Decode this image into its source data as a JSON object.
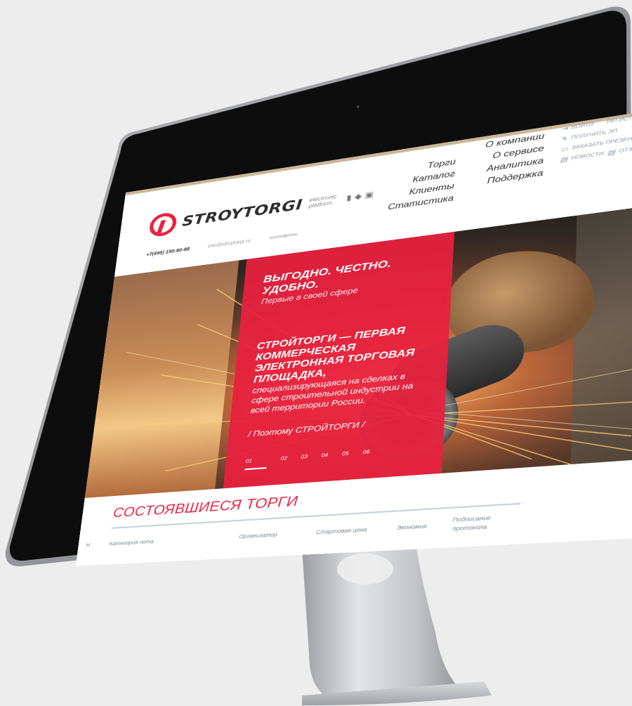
{
  "brand": {
    "name": "STROYTORGI",
    "tagline_1": "electronic",
    "tagline_2": "platform"
  },
  "contacts": {
    "phone": "+7(495) 150-80-88",
    "email": "info@stroytorgi.ru",
    "contacts_link": "контакты"
  },
  "nav": {
    "col1": [
      "Торги",
      "Каталог",
      "Клиенты",
      "Статистика"
    ],
    "col2": [
      "О компании",
      "О сервисе",
      "Аналитика",
      "Поддержка"
    ]
  },
  "utility": {
    "login": "ВОЙТИ",
    "register": "РЕГИСТРАЦИЯ",
    "get_ep": "ПОЛУЧИТЬ ЭП",
    "order_presentation": "ЗАКАЗАТЬ ПРЕЗЕНТАЦИЮ",
    "news": "НОВОСТИ",
    "reviews": "ОТЗЫВЫ"
  },
  "hero": {
    "slogan": "ВЫГОДНО. ЧЕСТНО. УДОБНО.",
    "slogan_sub": "Первые в своей сфере",
    "headline": "СТРОЙТОРГИ — ПЕРВАЯ КОММЕРЧЕСКАЯ ЭЛЕКТРОННАЯ ТОРГОВАЯ ПЛОЩАДКА,",
    "body": "специализирующаяся на сделках в сфере строительной индустрии на всей территории России.",
    "link": "/ Поэтому СТРОЙТОРГИ /",
    "tabs": [
      "01",
      "02",
      "03",
      "04",
      "05",
      "06"
    ],
    "active_tab": "01"
  },
  "section": {
    "title": "СОСТОЯВШИЕСЯ ТОРГИ",
    "columns": {
      "num": "Н",
      "category": "Категория лота",
      "organizer": "Организатор",
      "start_price": "Стартовая цена",
      "savings": "Экономия",
      "protocol": "Подписание протокола"
    }
  },
  "colors": {
    "accent": "#e8213f",
    "bezel": "#0d0d0d",
    "background": "#ededed",
    "stand": "#c8c9cb"
  }
}
